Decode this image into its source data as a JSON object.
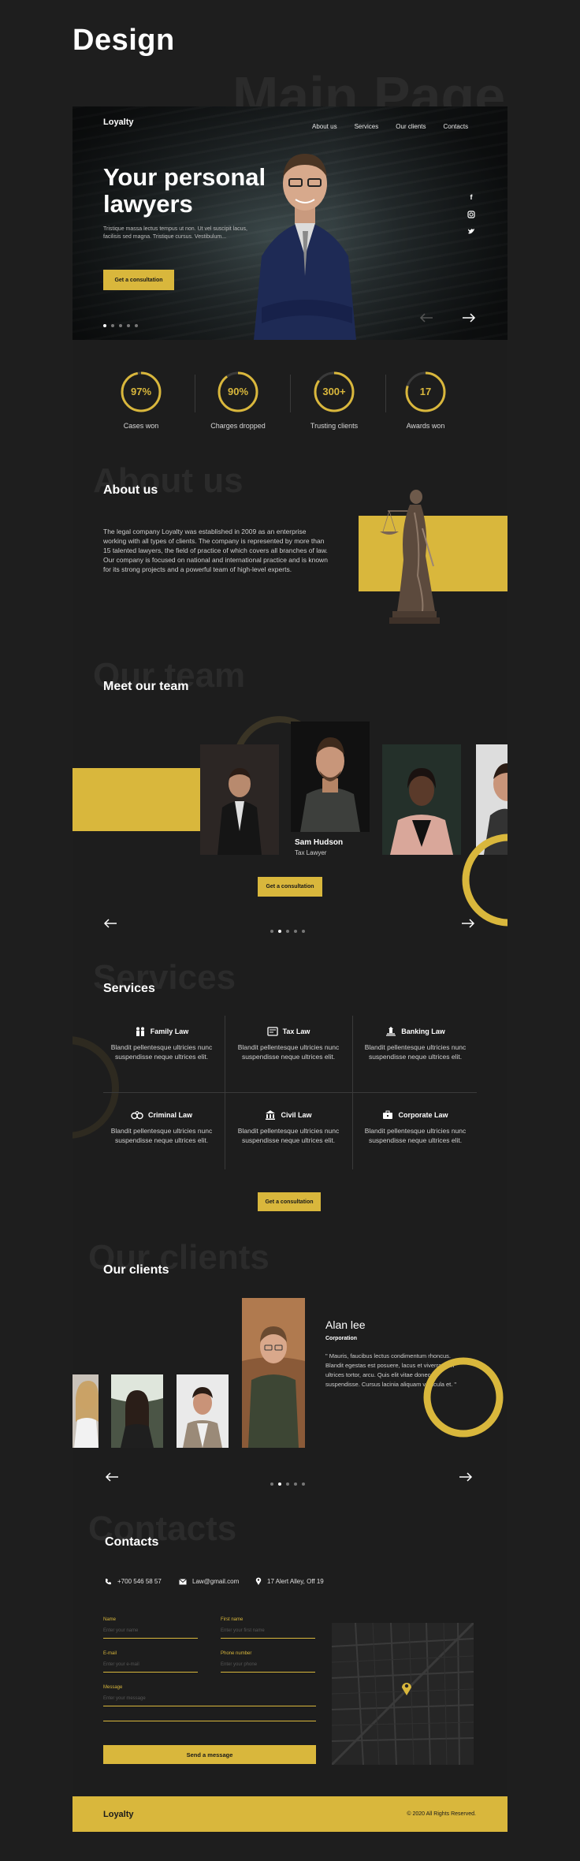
{
  "page": {
    "title": "Design",
    "ghost_title": "Main Page"
  },
  "hero": {
    "brand": "Loyalty",
    "nav": [
      "About us",
      "Services",
      "Our clients",
      "Contacts"
    ],
    "heading": [
      "Your personal",
      "lawyers"
    ],
    "text": "Tristique massa lectus tempus ut non. Ut vel suscipit lacus, facilisis sed magna. Tristique cursus. Vestibulum...",
    "cta": "Get a consultation",
    "social": [
      "f",
      "ig",
      "tw"
    ]
  },
  "stats": [
    {
      "value": "97%",
      "label": "Cases won",
      "progress": 0.97
    },
    {
      "value": "90%",
      "label": "Charges dropped",
      "progress": 0.9
    },
    {
      "value": "300+",
      "label": "Trusting clients",
      "progress": 0.85
    },
    {
      "value": "17",
      "label": "Awards won",
      "progress": 0.8
    }
  ],
  "about": {
    "ghost": "About us",
    "title": "About us",
    "text": "The legal company Loyalty was established in 2009 as an enterprise working with all types of clients. The company is represented by more than 15 talented lawyers, the field of practice of which covers all branches of law. Our company is focused on national and international practice and is known for its strong projects and a powerful team of high-level experts."
  },
  "team": {
    "ghost": "Our team",
    "title": "Meet our team",
    "featured_name": "Sam Hudson",
    "featured_role": "Tax Lawyer",
    "cta": "Get a consultation"
  },
  "services": {
    "ghost": "Services",
    "title": "Services",
    "items": [
      {
        "icon": "family-icon",
        "title": "Family Law",
        "text": "Blandit pellentesque ultricies nunc suspendisse neque ultrices elit."
      },
      {
        "icon": "tax-icon",
        "title": "Tax Law",
        "text": "Blandit pellentesque ultricies nunc suspendisse neque ultrices elit."
      },
      {
        "icon": "bank-icon",
        "title": "Banking Law",
        "text": "Blandit pellentesque ultricies nunc suspendisse neque ultrices elit."
      },
      {
        "icon": "handcuffs-icon",
        "title": "Criminal Law",
        "text": "Blandit pellentesque ultricies nunc suspendisse neque ultrices elit."
      },
      {
        "icon": "building-icon",
        "title": "Civil Law",
        "text": "Blandit pellentesque ultricies nunc suspendisse neque ultrices elit."
      },
      {
        "icon": "briefcase-icon",
        "title": "Corporate Law",
        "text": "Blandit pellentesque ultricies nunc suspendisse neque ultrices elit."
      }
    ],
    "cta": "Get a consultation"
  },
  "clients": {
    "ghost": "Our clients",
    "title": "Our clients",
    "name": "Alan lee",
    "company": "Corporation",
    "quote": "\" Mauris, faucibus lectus condimentum rhoncus. Blandit egestas est posuere, lacus et viverra nibh ultrices tortor, arcu. Quis elit vitae donec a suspendisse. Cursus lacinia aliquam vehicula et. \""
  },
  "contacts": {
    "ghost": "Contacts",
    "title": "Contacts",
    "phone": "+700 546 58 57",
    "email": "Law@gmail.com",
    "address": "17 Alert Alley, Off 19",
    "form": {
      "name_label": "Name",
      "name_ph": "Enter your name",
      "first_label": "First name",
      "first_ph": "Enter your first name",
      "email_label": "E-mail",
      "email_ph": "Enter your e-mail",
      "phone_label": "Phone number",
      "phone_ph": "Enter your phone",
      "message_label": "Message",
      "message_ph": "Enter your message",
      "submit": "Send a message"
    }
  },
  "footer": {
    "brand": "Loyalty",
    "copyright": "© 2020 All Rights Reserved."
  },
  "colors": {
    "accent": "#d9b73c",
    "bg": "#1e1e1e"
  }
}
